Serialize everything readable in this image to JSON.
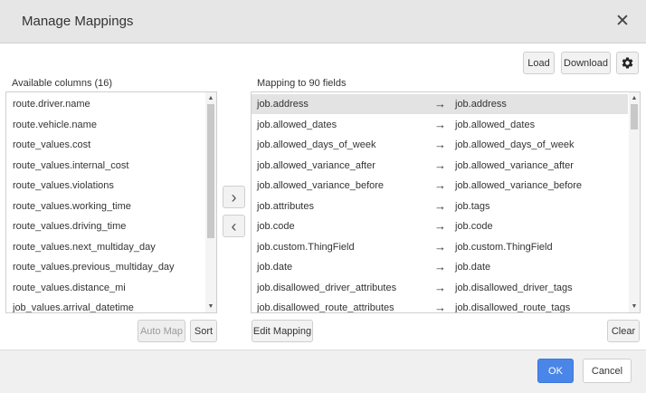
{
  "dialog": {
    "title": "Manage Mappings",
    "close_glyph": "✕"
  },
  "toolbar": {
    "load_label": "Load",
    "download_label": "Download",
    "settings_icon": "gear-icon"
  },
  "available": {
    "header": "Available columns (16)",
    "items": [
      "route.driver.name",
      "route.vehicle.name",
      "route_values.cost",
      "route_values.internal_cost",
      "route_values.violations",
      "route_values.working_time",
      "route_values.driving_time",
      "route_values.next_multiday_day",
      "route_values.previous_multiday_day",
      "route_values.distance_mi",
      "job_values.arrival_datetime"
    ],
    "auto_map_label": "Auto Map",
    "sort_label": "Sort"
  },
  "move": {
    "right_glyph": "›",
    "left_glyph": "‹"
  },
  "mapping": {
    "header": "Mapping to 90 fields",
    "arrow_glyph": "→",
    "rows": [
      {
        "source": "job.address",
        "target": "job.address",
        "selected": true
      },
      {
        "source": "job.allowed_dates",
        "target": "job.allowed_dates"
      },
      {
        "source": "job.allowed_days_of_week",
        "target": "job.allowed_days_of_week"
      },
      {
        "source": "job.allowed_variance_after",
        "target": "job.allowed_variance_after"
      },
      {
        "source": "job.allowed_variance_before",
        "target": "job.allowed_variance_before"
      },
      {
        "source": "job.attributes",
        "target": "job.tags"
      },
      {
        "source": "job.code",
        "target": "job.code"
      },
      {
        "source": "job.custom.ThingField",
        "target": "job.custom.ThingField"
      },
      {
        "source": "job.date",
        "target": "job.date"
      },
      {
        "source": "job.disallowed_driver_attributes",
        "target": "job.disallowed_driver_tags"
      },
      {
        "source": "job.disallowed_route_attributes",
        "target": "job.disallowed_route_tags"
      }
    ],
    "edit_label": "Edit Mapping",
    "clear_label": "Clear"
  },
  "footer": {
    "ok_label": "OK",
    "cancel_label": "Cancel"
  },
  "colors": {
    "primary": "#4a86e8",
    "header_bg": "#e6e6e6",
    "selected_row": "#e3e3e3"
  }
}
